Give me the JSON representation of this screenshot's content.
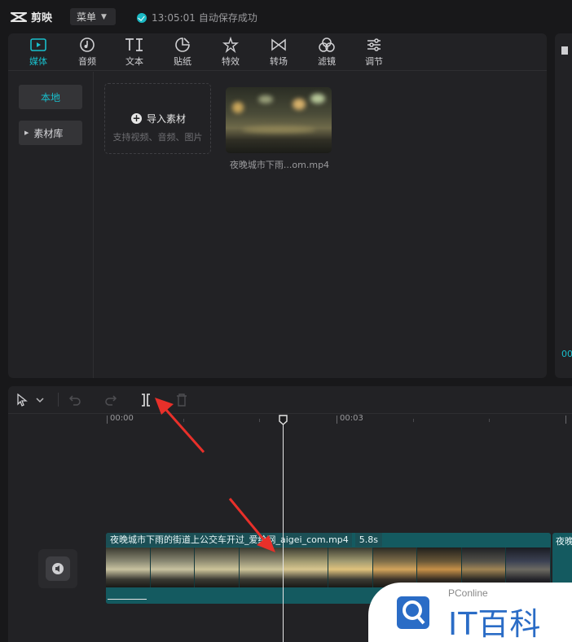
{
  "app": {
    "name": "剪映",
    "menu_label": "菜单"
  },
  "save_status": {
    "time": "13:05:01",
    "text": "自动保存成功"
  },
  "tabs": [
    {
      "label": "媒体",
      "icon": "media-icon",
      "active": true
    },
    {
      "label": "音频",
      "icon": "audio-icon"
    },
    {
      "label": "文本",
      "icon": "text-icon"
    },
    {
      "label": "贴纸",
      "icon": "sticker-icon"
    },
    {
      "label": "特效",
      "icon": "effects-icon"
    },
    {
      "label": "转场",
      "icon": "transition-icon"
    },
    {
      "label": "滤镜",
      "icon": "filter-icon"
    },
    {
      "label": "调节",
      "icon": "adjust-icon"
    }
  ],
  "side_nav": {
    "local": "本地",
    "library": "素材库"
  },
  "import": {
    "label": "导入素材",
    "hint": "支持视频、音频、图片"
  },
  "media_item": {
    "name": "夜晚城市下雨...om.mp4"
  },
  "right_panel": {
    "time_fragment": "00"
  },
  "timeline": {
    "ruler": {
      "start": "00:00",
      "mid": "00:03"
    },
    "clip": {
      "name": "夜晚城市下雨的街道上公交车开过_爱给网_aigei_com.mp4",
      "duration": "5.8s"
    },
    "clip2_label": "夜晚"
  },
  "watermark": {
    "brand_small": "PConline",
    "brand_big": "IT百科"
  },
  "colors": {
    "accent": "#19bfcc",
    "clip": "#145a60",
    "arrow": "#e8302a"
  }
}
